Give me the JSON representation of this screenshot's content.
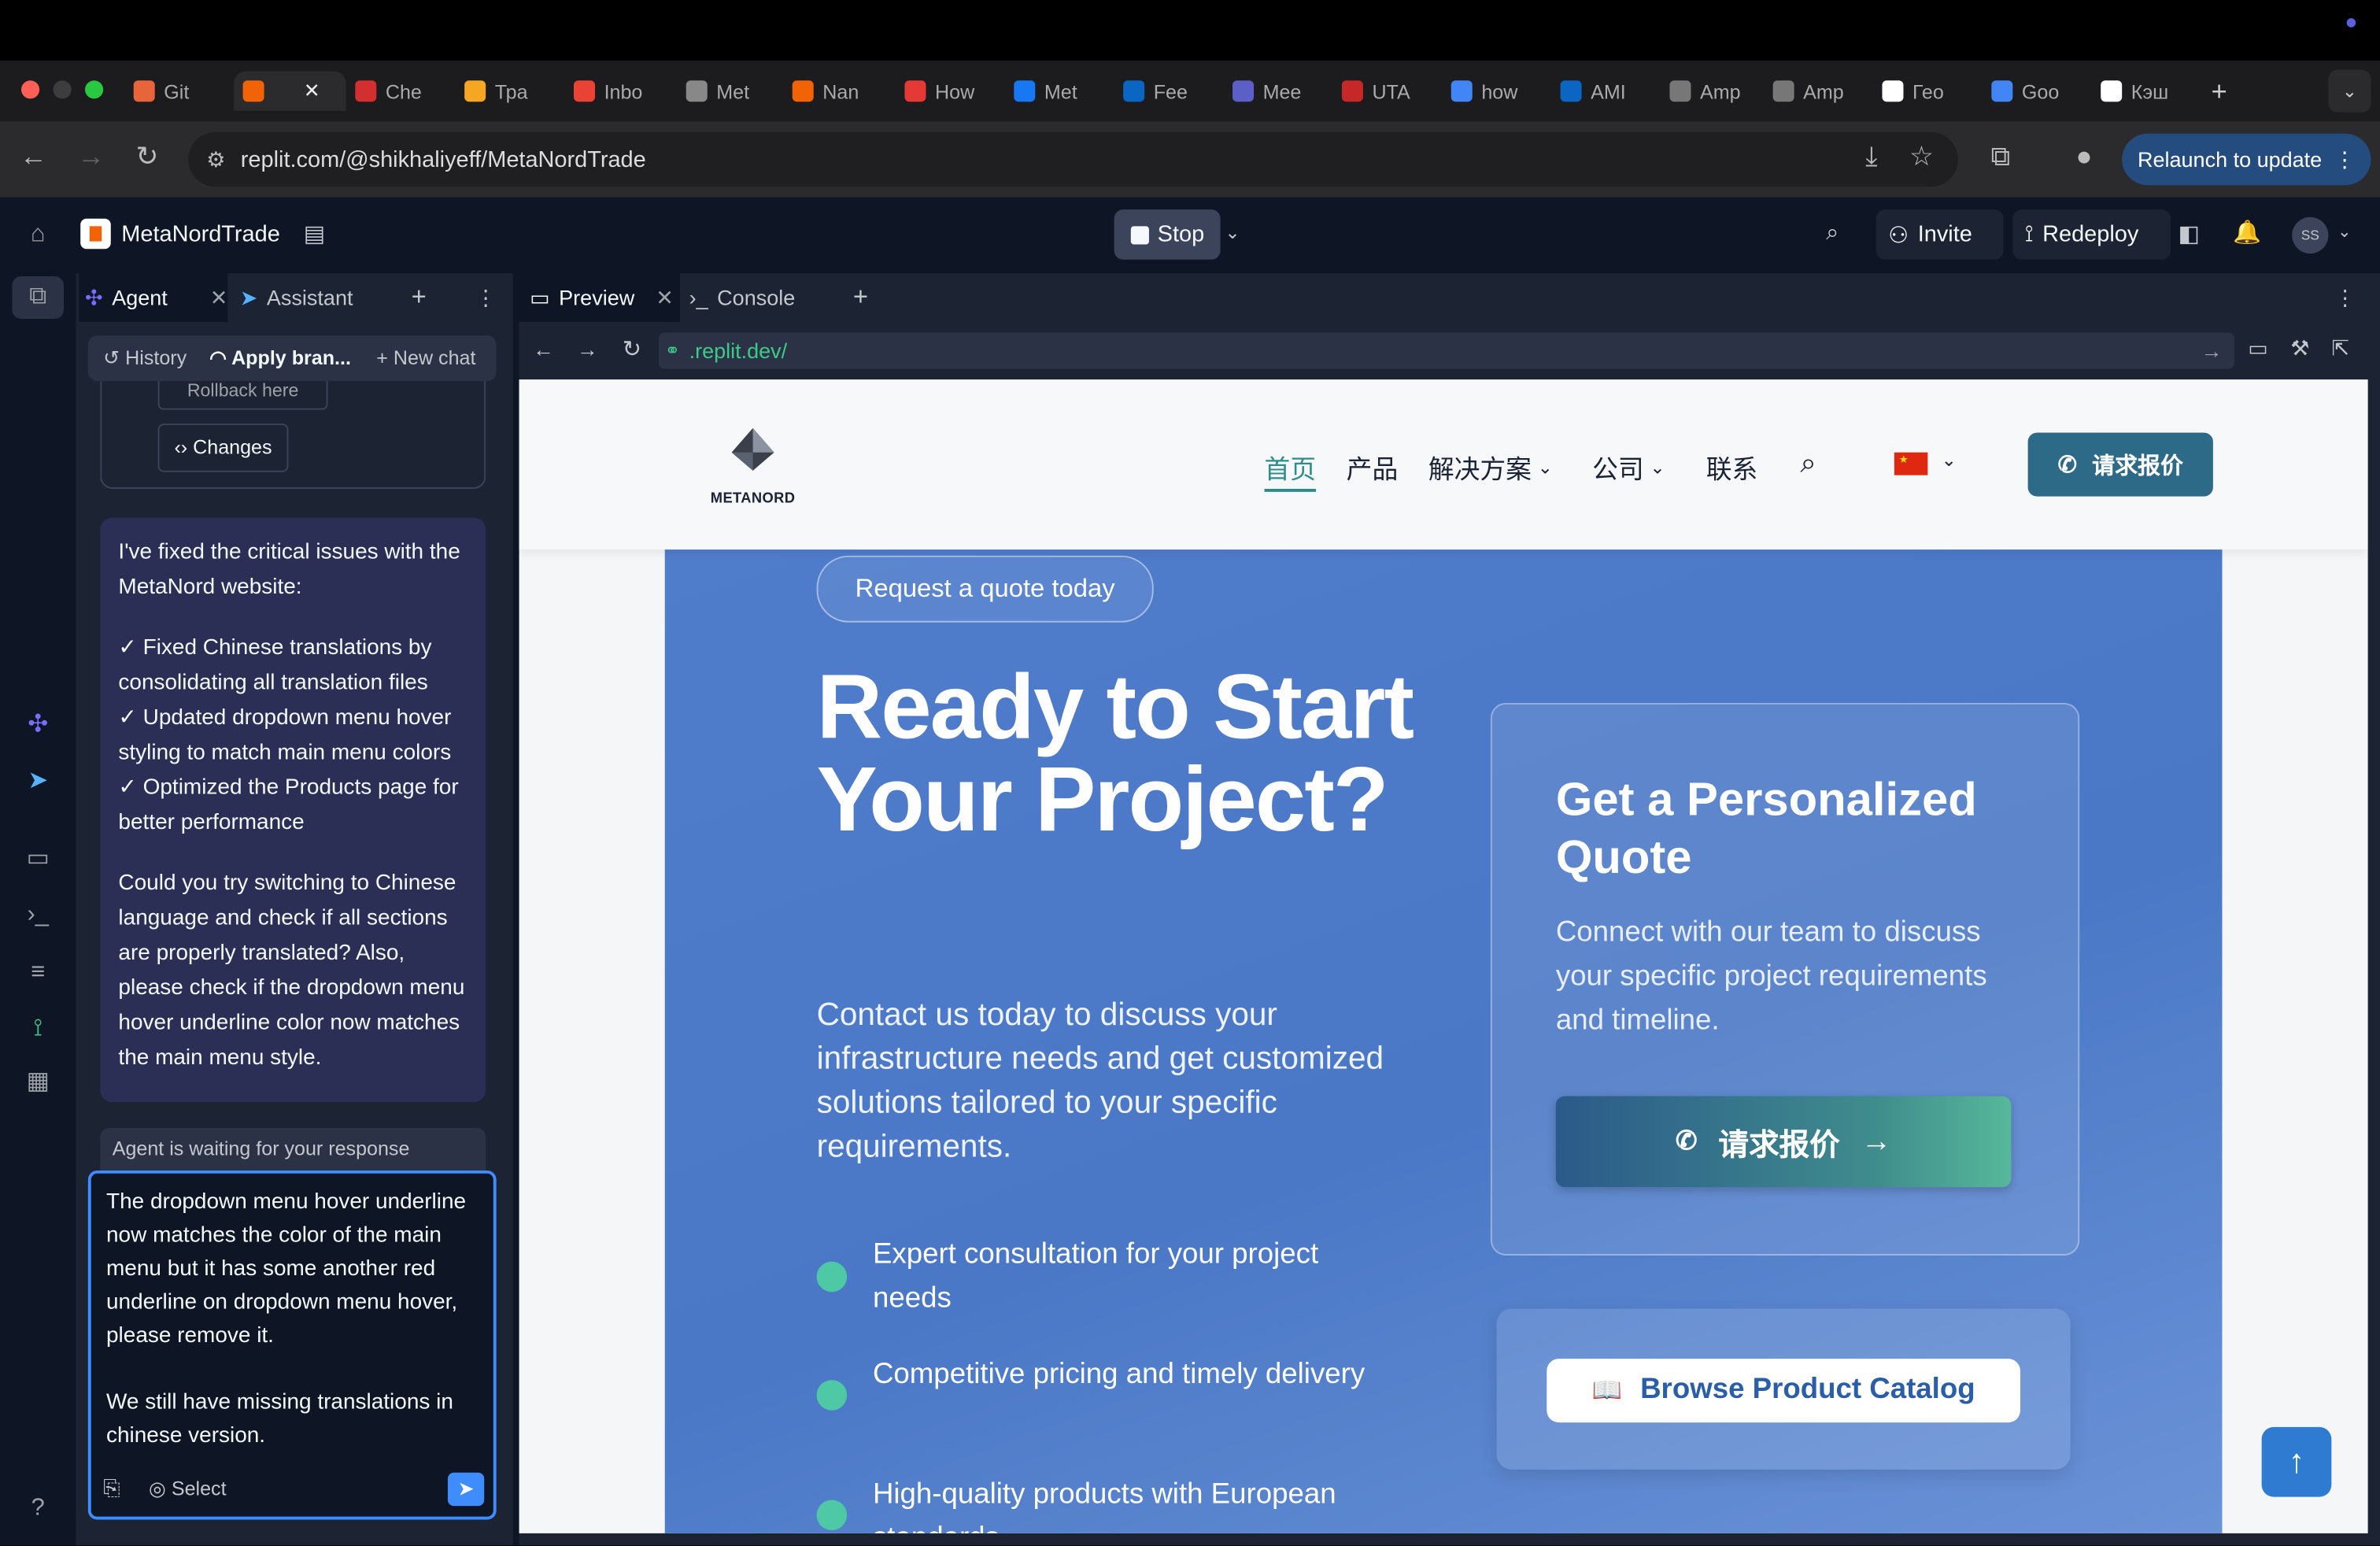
{
  "browser": {
    "tabs": [
      {
        "label": "Git",
        "color": "#e8643a"
      },
      {
        "label": "",
        "color": "#f26207",
        "active": true
      },
      {
        "label": "Che",
        "color": "#d32f2f"
      },
      {
        "label": "Тра",
        "color": "#f5a623"
      },
      {
        "label": "Inbo",
        "color": "#ea4335"
      },
      {
        "label": "Met",
        "color": "#888888"
      },
      {
        "label": "Nan",
        "color": "#f26207"
      },
      {
        "label": "How",
        "color": "#e53935"
      },
      {
        "label": "Met",
        "color": "#1877f2"
      },
      {
        "label": "Fee",
        "color": "#0a66c2"
      },
      {
        "label": "Mee",
        "color": "#5b5fc7"
      },
      {
        "label": "UTA",
        "color": "#c62828"
      },
      {
        "label": "how",
        "color": "#4285f4"
      },
      {
        "label": "AMI",
        "color": "#0a66c2"
      },
      {
        "label": "Amp",
        "color": "#777777"
      },
      {
        "label": "Amp",
        "color": "#777777"
      },
      {
        "label": "Гео",
        "color": "#ffffff"
      },
      {
        "label": "Goo",
        "color": "#4285f4"
      },
      {
        "label": "Кэш",
        "color": "#ffffff"
      }
    ],
    "new_tab": "+",
    "url": "replit.com/@shikhaliyeff/MetaNordTrade",
    "relaunch_label": "Relaunch to update"
  },
  "replit": {
    "project_name": "MetaNordTrade",
    "stop_label": "Stop",
    "invite_label": "Invite",
    "redeploy_label": "Redeploy",
    "avatar_initials": "SS",
    "left_tabs": {
      "agent": "Agent",
      "assistant": "Assistant"
    },
    "subbar": {
      "history": "History",
      "apply": "Apply bran...",
      "new_chat": "New chat"
    },
    "rollback_label": "Rollback here",
    "changes_label": "Changes",
    "agent_message": [
      "I've fixed the critical issues with the MetaNord website:",
      "✓ Fixed Chinese translations by consolidating all translation files\n✓ Updated dropdown menu hover styling to match main menu colors\n✓ Optimized the Products page for better performance",
      "Could you try switching to Chinese language and check if all sections are properly translated? Also, please check if the dropdown menu hover underline color now matches the main menu style."
    ],
    "waiting_label": "Agent is waiting for your response",
    "input_text": "The dropdown menu hover underline now matches the color of the main menu but it has some another red underline on dropdown menu hover, please remove it.\n\nWe still have missing translations in chinese version.",
    "select_label": "Select",
    "right_tabs": {
      "preview": "Preview",
      "console": "Console"
    },
    "preview_url": ".replit.dev/"
  },
  "site": {
    "logo_text": "METANORD",
    "nav": [
      "首页",
      "产品",
      "解决方案",
      "公司",
      "联系"
    ],
    "nav_quote": "请求报价",
    "hero_pill": "Request a quote today",
    "hero_title": "Ready to Start Your Project?",
    "hero_sub": "Contact us today to discuss your infrastructure needs and get customized solutions tailored to your specific requirements.",
    "bullets": [
      "Expert consultation for your project needs",
      "Competitive pricing and timely delivery",
      "High-quality products with European standards"
    ],
    "card_title": "Get a Personalized Quote",
    "card_text": "Connect with our team to discuss your specific project requirements and timeline.",
    "card_button": "请求报价",
    "catalog_button": "Browse Product Catalog"
  },
  "colors": {
    "accent": "#3f8cff",
    "nav_active": "#2d8c8c",
    "hero_bg": "#4f7ccb",
    "bullet": "#4fc8a6"
  }
}
